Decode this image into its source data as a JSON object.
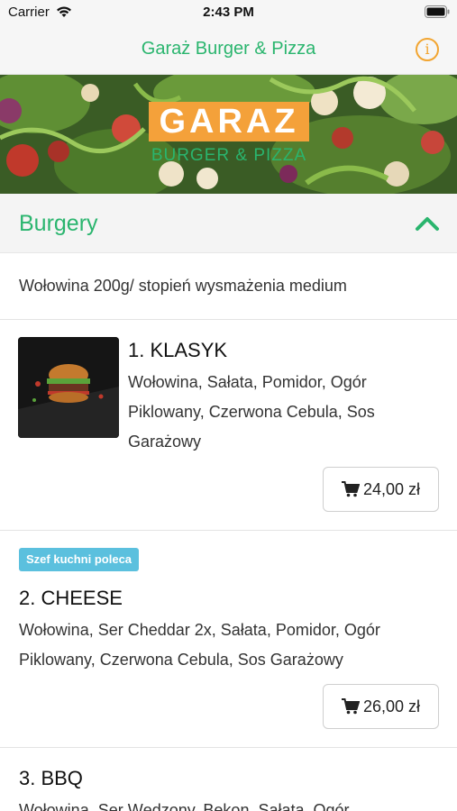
{
  "status_bar": {
    "carrier": "Carrier",
    "time": "2:43 PM"
  },
  "nav": {
    "title": "Garaż Burger & Pizza",
    "info_icon": "info-circle-icon"
  },
  "hero": {
    "logo_main": "GARAZ",
    "logo_sub": "BURGER & PIZZA"
  },
  "section": {
    "title": "Burgery",
    "description": "Wołowina 200g/ stopień wysmażenia medium",
    "collapse_icon": "chevron-up-icon"
  },
  "items": [
    {
      "title": "1. KLASYK",
      "desc_line1": "Wołowina, Sałata, Pomidor, Ogór",
      "desc_line2": "Piklowany, Czerwona Cebula, Sos",
      "desc_line3": "Garażowy",
      "price": "24,00 zł"
    },
    {
      "badge": "Szef kuchni poleca",
      "title": "2. CHEESE",
      "desc_line1": "Wołowina, Ser Cheddar 2x, Sałata, Pomidor, Ogór",
      "desc_line2": "Piklowany, Czerwona Cebula, Sos Garażowy",
      "price": "26,00 zł"
    },
    {
      "title": "3. BBQ",
      "desc_line1": "Wołowina, Ser Wędzony, Bekon, Sałata, Ogór"
    }
  ],
  "colors": {
    "accent": "#2ab56e",
    "info": "#f2a531",
    "badge": "#5bc0de"
  }
}
